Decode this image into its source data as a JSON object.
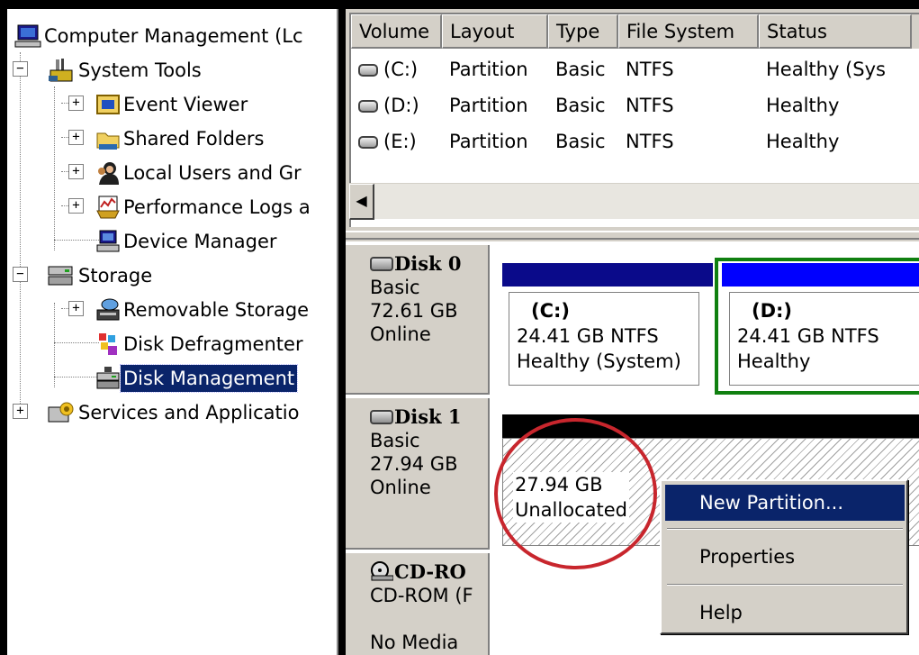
{
  "tree": {
    "root": "Computer Management (Lc",
    "items": [
      {
        "label": "System Tools",
        "expander": "−"
      },
      {
        "label": "Event Viewer",
        "expander": "+"
      },
      {
        "label": "Shared Folders",
        "expander": "+"
      },
      {
        "label": "Local Users and Gr",
        "expander": "+"
      },
      {
        "label": "Performance Logs a",
        "expander": "+"
      },
      {
        "label": "Device Manager",
        "expander": ""
      },
      {
        "label": "Storage",
        "expander": "−"
      },
      {
        "label": "Removable Storage",
        "expander": "+"
      },
      {
        "label": "Disk Defragmenter",
        "expander": ""
      },
      {
        "label": "Disk Management",
        "expander": "",
        "selected": true
      },
      {
        "label": "Services and Applicatio",
        "expander": "+"
      }
    ]
  },
  "volume_list": {
    "columns": [
      "Volume",
      "Layout",
      "Type",
      "File System",
      "Status"
    ],
    "rows": [
      {
        "volume": "(C:)",
        "layout": "Partition",
        "type": "Basic",
        "fs": "NTFS",
        "status": "Healthy (Sys"
      },
      {
        "volume": "(D:)",
        "layout": "Partition",
        "type": "Basic",
        "fs": "NTFS",
        "status": "Healthy"
      },
      {
        "volume": "(E:)",
        "layout": "Partition",
        "type": "Basic",
        "fs": "NTFS",
        "status": "Healthy"
      }
    ],
    "scroll_left_glyph": "◀"
  },
  "disks": {
    "disk0": {
      "name": "Disk 0",
      "kind": "Basic",
      "size": "72.61 GB",
      "state": "Online",
      "partitions": [
        {
          "title": "(C:)",
          "size_fs": "24.41 GB NTFS",
          "status": "Healthy (System)"
        },
        {
          "title": "(D:)",
          "size_fs": "24.41 GB NTFS",
          "status": "Healthy"
        }
      ]
    },
    "disk1": {
      "name": "Disk 1",
      "kind": "Basic",
      "size": "27.94 GB",
      "state": "Online",
      "unallocated": {
        "size": "27.94 GB",
        "status": "Unallocated"
      }
    },
    "cdrom": {
      "name": "CD-RO",
      "kind": "CD-ROM (F",
      "state": "No Media"
    }
  },
  "context_menu": {
    "items": [
      "New Partition...",
      "Properties",
      "Help"
    ]
  },
  "colors": {
    "selection": "#0a246a",
    "primary_partition_bar": "#0a0a8a",
    "logical_bar": "#0000ff",
    "unallocated_bar": "#000000",
    "annotation": "#c8262d"
  }
}
